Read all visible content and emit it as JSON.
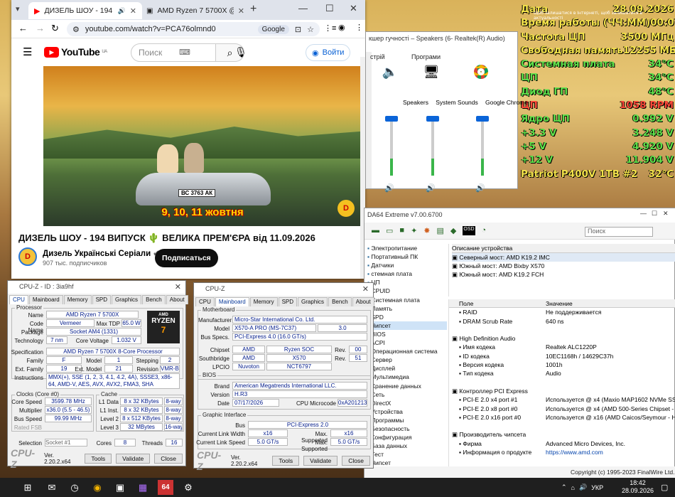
{
  "sensors": {
    "tooltip": "Щоб залишатися в Інтернеті, щоб залишатися в актуальності",
    "rows": [
      {
        "label": "Дата",
        "value": "28.09.2026",
        "color": "yellow"
      },
      {
        "label": "Время работы (ЧЧ:ММ)",
        "value": "00:07",
        "color": "yellow"
      },
      {
        "label": "Частота ЦП",
        "value": "3500 МГц",
        "color": "yellow"
      },
      {
        "label": "Свободная память",
        "value": "12255 МБ",
        "color": "yellow"
      },
      {
        "label": "Системная плата",
        "value": "34°C",
        "color": "green"
      },
      {
        "label": "ЦП",
        "value": "34°C",
        "color": "green"
      },
      {
        "label": "Диод ГП",
        "value": "48°C",
        "color": "green"
      },
      {
        "label": "ЦП",
        "value": "1058 RPM",
        "color": "red"
      },
      {
        "label": "Ядро ЦП",
        "value": "0.992 V",
        "color": "green"
      },
      {
        "label": "+3.3 V",
        "value": "3.248 V",
        "color": "green"
      },
      {
        "label": "+5 V",
        "value": "4.920 V",
        "color": "green"
      },
      {
        "label": "+12 V",
        "value": "11.904 V",
        "color": "green"
      },
      {
        "label": "Patriot P400V 1TB #2",
        "value": "32°C",
        "color": "yellow"
      }
    ]
  },
  "browser": {
    "tab1": "ДИЗЕЛЬ ШОУ - 194 ВИПУСК",
    "tab2": "AMD Ryzen 7 5700X @ 3599.6",
    "url": "youtube.com/watch?v=PCA76olmnd0",
    "google_pill": "Google",
    "yt_logo": "YouTube",
    "yt_region": "UA",
    "search_placeholder": "Поиск",
    "signin": "Войти",
    "video_caption": "9, 10, 11 жовтня",
    "plate": "ВС 3763 АК",
    "title": "ДИЗЕЛЬ ШОУ - 194 ВИПУСК 🌵 ВЕЛИКА ПРЕМ'ЄРА від 11.09.2026",
    "channel": "Дизель Українські Серіали",
    "channel_avatar": "D",
    "subs": "907 тыс. подписчиков",
    "subscribe": "Подписаться"
  },
  "mixer": {
    "title": "кшер гучності – Speakers (6- Realtek(R) Audio)",
    "device_label": "стрій",
    "apps_label": "Програми",
    "cols": [
      {
        "name": "Speakers",
        "level": 0.3
      },
      {
        "name": "System Sounds",
        "level": 0.3
      },
      {
        "name": "Google Chrome",
        "level": 0.3
      }
    ]
  },
  "aida": {
    "title": "DA64 Extreme v7.00.6700",
    "search_placeholder": "Поиск",
    "tree": [
      "Электропитание",
      "Портативный ПК",
      "Датчики",
      "стемная плата",
      "ЦП",
      "CPUID",
      "Системная плата",
      "Память",
      "SPD",
      "Чипсет",
      "BIOS",
      "ACPI",
      "Операционная система",
      "Сервер",
      "Дисплей",
      "Мультимедиа",
      "Хранение данных",
      "Сеть",
      "DirectX",
      "Устройства",
      "Программы",
      "Безопасность",
      "Конфигурация",
      "База данных",
      "Тест",
      "Чипсет"
    ],
    "desc_header": "Описание устройства",
    "desc_rows": [
      "Северный мост: AMD K19.2 IMC",
      "Южный мост: AMD Bixby X570",
      "Южный мост: AMD K19.2 FCH"
    ],
    "col_field": "Поле",
    "col_value": "Значение",
    "rows": [
      {
        "f": "RAID",
        "v": "Не поддерживается",
        "h": false
      },
      {
        "f": "DRAM Scrub Rate",
        "v": "640 ns",
        "h": false
      },
      {
        "f": "",
        "v": "",
        "h": false
      },
      {
        "f": "High Definition Audio",
        "v": "",
        "h": true
      },
      {
        "f": "Имя кодека",
        "v": "Realtek ALC1220P",
        "h": false
      },
      {
        "f": "ID кодека",
        "v": "10EC1168h / 14629C37h",
        "h": false
      },
      {
        "f": "Версия кодека",
        "v": "1001h",
        "h": false
      },
      {
        "f": "Тип кодека",
        "v": "Audio",
        "h": false
      },
      {
        "f": "",
        "v": "",
        "h": false
      },
      {
        "f": "Контроллер PCI Express",
        "v": "",
        "h": true
      },
      {
        "f": "PCI-E 2.0 x4 port #1",
        "v": "Используется @ x4 (Maxio MAP1602 NVMe SSD",
        "h": false
      },
      {
        "f": "PCI-E 2.0 x8 port #0",
        "v": "Используется @ x4 (AMD 500-Series Chipset - S",
        "h": false
      },
      {
        "f": "PCI-E 2.0 x16 port #0",
        "v": "Используется @ x16 (AMD Caicos/Seymour - H",
        "h": false
      },
      {
        "f": "",
        "v": "",
        "h": false
      },
      {
        "f": "Производитель чипсета",
        "v": "",
        "h": true
      },
      {
        "f": "Фирма",
        "v": "Advanced Micro Devices, Inc.",
        "h": false
      },
      {
        "f": "Информация о продукте",
        "v": "https://www.amd.com",
        "h": false
      }
    ],
    "footer": "Copyright (c) 1995-2023 FinalWire Ltd."
  },
  "cpuz1": {
    "title": "CPU-Z - ID : 3ia9hf",
    "tabs": [
      "CPU",
      "Mainboard",
      "Memory",
      "SPD",
      "Graphics",
      "Bench",
      "About"
    ],
    "group_processor": "Processor",
    "name_l": "Name",
    "name": "AMD Ryzen 7 5700X",
    "code_l": "Code Name",
    "code": "Vermeer",
    "tdp_l": "Max TDP",
    "tdp": "65.0 W",
    "pkg_l": "Package",
    "pkg": "Socket AM4 (1331)",
    "tech_l": "Technology",
    "tech": "7 nm",
    "volt_l": "Core Voltage",
    "volt": "1.032 V",
    "spec_l": "Specification",
    "spec": "AMD Ryzen 7 5700X 8-Core Processor",
    "fam_l": "Family",
    "fam": "F",
    "model_l": "Model",
    "model": "1",
    "step_l": "Stepping",
    "step": "2",
    "efam_l": "Ext. Family",
    "efam": "19",
    "emod_l": "Ext. Model",
    "emod": "21",
    "rev_l": "Revision",
    "rev": "VMR-B2",
    "inst_l": "Instructions",
    "inst": "MMX(+), SSE (1, 2, 3, 4.1, 4.2, 4A), SSSE3, x86-64, AMD-V, AES, AVX, AVX2, FMA3, SHA",
    "group_clocks": "Clocks (Core #0)",
    "group_cache": "Cache",
    "cs_l": "Core Speed",
    "cs": "3599.78 MHz",
    "mul_l": "Multiplier",
    "mul": "x36.0 (5.5 - 46.5)",
    "bus_l": "Bus Speed",
    "bus": "99.99 MHz",
    "fsb_l": "Rated FSB",
    "l1d_l": "L1 Data",
    "l1d": "8 x 32 KBytes",
    "l1dw": "8-way",
    "l1i_l": "L1 Inst.",
    "l1i": "8 x 32 KBytes",
    "l1iw": "8-way",
    "l2_l": "Level 2",
    "l2": "8 x 512 KBytes",
    "l2w": "8-way",
    "l3_l": "Level 3",
    "l3": "32 MBytes",
    "l3w": "16-way",
    "sel_l": "Selection",
    "sel": "Socket #1",
    "cores_l": "Cores",
    "cores": "8",
    "thr_l": "Threads",
    "thr": "16",
    "badge_brand": "RYZEN",
    "badge_num": "7",
    "badge_vendor": "AMD",
    "logo": "CPU-Z",
    "ver": "Ver. 2.20.2.x64",
    "tools": "Tools",
    "validate": "Validate",
    "close": "Close"
  },
  "cpuz2": {
    "title": "CPU-Z",
    "tabs": [
      "CPU",
      "Mainboard",
      "Memory",
      "SPD",
      "Graphics",
      "Bench",
      "About"
    ],
    "group_mb": "Motherboard",
    "man_l": "Manufacturer",
    "man": "Micro-Star International Co. Ltd.",
    "mod_l": "Model",
    "mod": "X570-A PRO (MS-7C37)",
    "modrev": "3.0",
    "bspec_l": "Bus Specs.",
    "bspec": "PCI-Express 4.0 (16.0 GT/s)",
    "chip_l": "Chipset",
    "chip": "AMD",
    "chip2": "Ryzen SOC",
    "chiprev_l": "Rev.",
    "chiprev": "00",
    "sb_l": "Southbridge",
    "sb": "AMD",
    "sb2": "X570",
    "sbrev_l": "Rev.",
    "sbrev": "51",
    "lpc_l": "LPCIO",
    "lpc": "Nuvoton",
    "lpc2": "NCT6797",
    "group_bios": "BIOS",
    "brand_l": "Brand",
    "brand": "American Megatrends International LLC.",
    "bver_l": "Version",
    "bver": "H.R3",
    "date_l": "Date",
    "date": "07/17/2026",
    "micro_l": "CPU Microcode",
    "micro": "0xA201213",
    "group_gi": "Graphic Interface",
    "gbus_l": "Bus",
    "gbus": "PCI-Express 2.0",
    "clw_l": "Current Link Width",
    "clw": "x16",
    "msw_l": "Max. Supported",
    "msw": "x16",
    "cls_l": "Current Link Speed",
    "cls": "5.0 GT/s",
    "mss_l": "Max. Supported",
    "mss": "5.0 GT/s",
    "logo": "CPU-Z",
    "ver": "Ver. 2.20.2.x64",
    "tools": "Tools",
    "validate": "Validate",
    "close": "Close"
  },
  "taskbar": {
    "lang": "УКР",
    "time": "18:42",
    "date": "28.09.2026",
    "aida_label": "64"
  }
}
